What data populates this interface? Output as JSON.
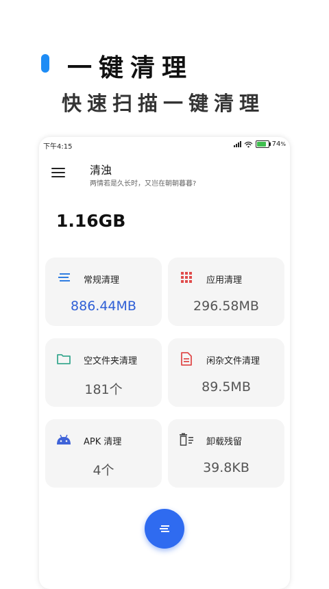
{
  "promo": {
    "title": "一键清理",
    "subtitle": "快速扫描一键清理"
  },
  "status_bar": {
    "time": "下午4:15",
    "battery_percent": "74",
    "battery_unit": "%"
  },
  "header": {
    "title": "清浊",
    "subtitle": "两情若是久长时，又岂在朝朝暮暮?"
  },
  "total_size": "1.16GB",
  "cards": [
    {
      "label": "常规清理",
      "value": "886.44MB",
      "icon": "list-lines-icon",
      "color": "#2f7de1"
    },
    {
      "label": "应用清理",
      "value": "296.58MB",
      "icon": "app-grid-icon",
      "color": "#e04c4c"
    },
    {
      "label": "空文件夹清理",
      "value": "181个",
      "icon": "folder-icon",
      "color": "#3aa890"
    },
    {
      "label": "闲杂文件清理",
      "value": "89.5MB",
      "icon": "document-icon",
      "color": "#e04c4c"
    },
    {
      "label": "APK 清理",
      "value": "4个",
      "icon": "android-icon",
      "color": "#3f63d8"
    },
    {
      "label": "卸载残留",
      "value": "39.8KB",
      "icon": "trash-list-icon",
      "color": "#444444"
    }
  ],
  "colors": {
    "accent": "#2f6bf0",
    "promo_bar": "#1e8cf5",
    "highlight_value": "#2f5fd6"
  }
}
